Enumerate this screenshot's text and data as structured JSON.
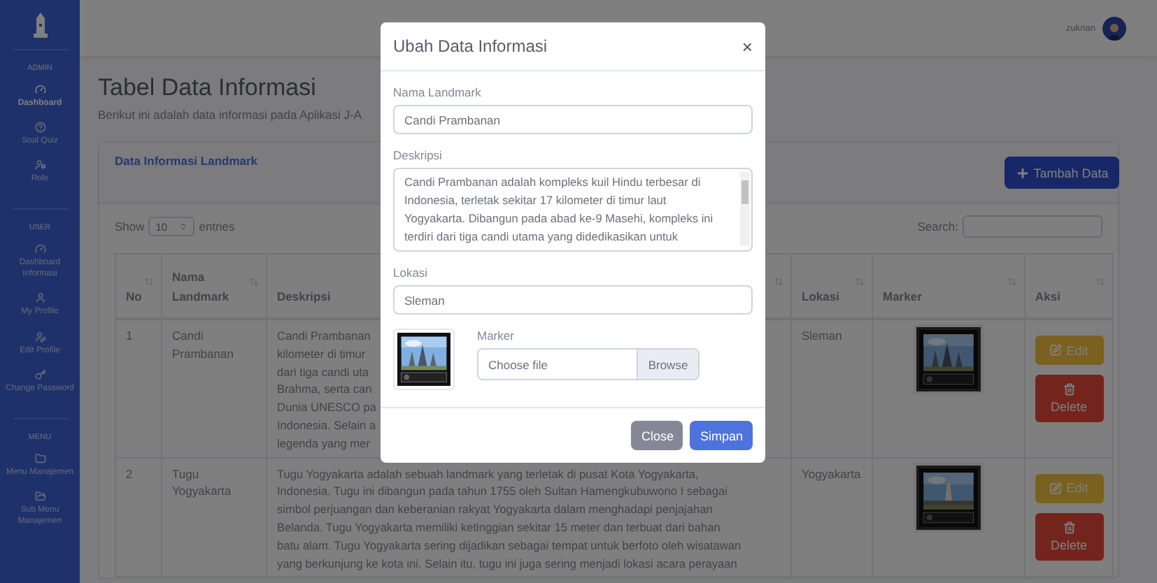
{
  "sidebar": {
    "sections": [
      {
        "heading": "ADMIN",
        "items": [
          {
            "label": "Dashboard",
            "selected": true
          },
          {
            "label": "Soal Quiz",
            "selected": false
          },
          {
            "label": "Role",
            "selected": false
          }
        ]
      },
      {
        "heading": "USER",
        "items": [
          {
            "label": "Dashboard Informasi",
            "selected": false
          },
          {
            "label": "My Profile",
            "selected": false
          },
          {
            "label": "Edit Profile",
            "selected": false
          },
          {
            "label": "Change Password",
            "selected": false
          }
        ]
      },
      {
        "heading": "MENU",
        "items": [
          {
            "label": "Menu Manajemen",
            "selected": false
          },
          {
            "label": "Sub Menu Manajemen",
            "selected": false
          }
        ]
      }
    ]
  },
  "topbar": {
    "user_name": "zukrian"
  },
  "page": {
    "title": "Tabel Data Informasi",
    "subtitle": "Berikut ini adalah data informasi pada Aplikasi J-A"
  },
  "card": {
    "title": "Data Informasi Landmark",
    "add_button": "Tambah Data",
    "show_label": "Show",
    "page_size": "10",
    "entries_label": "entries",
    "search_label": "Search:",
    "table": {
      "columns": [
        "No",
        "Nama Landmark",
        "Deskripsi",
        "Lokasi",
        "Marker",
        "Aksi"
      ],
      "rows": [
        {
          "no": "1",
          "name": "Candi Prambanan",
          "description_lines": [
            "Candi Prambanan",
            "kilometer di timur",
            "dari tiga candi uta",
            "Brahma, serta can",
            "Dunia UNESCO pa",
            "Indonesia. Selain a",
            "legenda yang mer"
          ],
          "location": "Sleman",
          "marker": {
            "kind": "picture"
          },
          "actions": [
            {
              "kind": "edit",
              "label": "Edit"
            },
            {
              "kind": "delete",
              "label": "Delete"
            }
          ]
        },
        {
          "no": "2",
          "name": "Tugu Yogyakarta",
          "description_lines": [
            "Tugu Yogyakarta adalah sebuah landmark yang terletak di pusat Kota Yogyakarta,",
            "Indonesia. Tugu ini dibangun pada tahun 1755 oleh Sultan Hamengkubuwono I sebagai",
            "simbol perjuangan dan keberanian rakyat Yogyakarta dalam menghadapi penjajahan",
            "Belanda. Tugu Yogyakarta memiliki ketinggian sekitar 15 meter dan terbuat dari bahan",
            "batu alam. Tugu Yogyakarta sering dijadikan sebagai tempat untuk berfoto oleh wisatawan",
            "yang berkunjung ke kota ini. Selain itu, tugu ini juga sering menjadi lokasi acara perayaan"
          ],
          "location": "Yogyakarta",
          "marker": {
            "kind": "picture"
          },
          "actions": [
            {
              "kind": "edit",
              "label": "Edit"
            },
            {
              "kind": "delete",
              "label": "Delete"
            }
          ]
        }
      ]
    }
  },
  "modal": {
    "title": "Ubah Data Informasi",
    "close": "×",
    "fields": [
      {
        "kind": "input",
        "label": "Nama Landmark",
        "value": "Candi Prambanan"
      },
      {
        "kind": "textarea",
        "label": "Deskripsi",
        "lines": [
          "Candi Prambanan adalah kompleks kuil Hindu terbesar di",
          "Indonesia, terletak sekitar 17 kilometer di timur laut",
          "Yogyakarta. Dibangun pada abad ke-9 Masehi, kompleks ini",
          "terdiri dari tiga candi utama yang didedikasikan untuk"
        ]
      },
      {
        "kind": "input",
        "label": "Lokasi",
        "value": "Sleman"
      }
    ],
    "marker": {
      "label": "Marker",
      "placeholder": "Choose file",
      "button": "Browse",
      "preview": {
        "kind": "picture"
      }
    },
    "buttons": [
      {
        "kind": "secondary",
        "label": "Close"
      },
      {
        "kind": "primary",
        "label": "Simpan"
      }
    ]
  }
}
